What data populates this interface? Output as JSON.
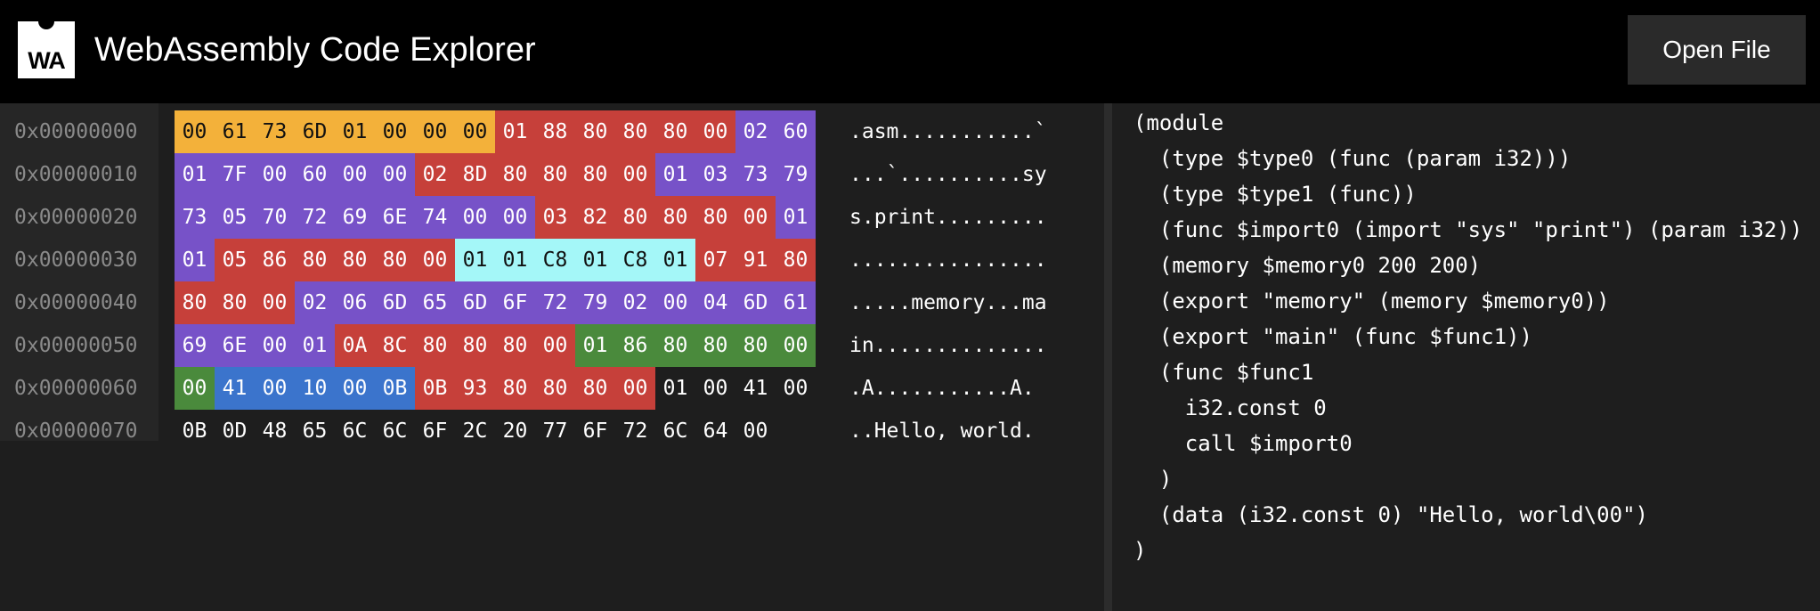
{
  "header": {
    "logo_text": "WA",
    "title": "WebAssembly Code Explorer",
    "open_file_label": "Open File"
  },
  "colors": {
    "header_section": "#f3b13a",
    "section_id_size": "#c6403a",
    "section_payload": "#7752c8",
    "function_body": "#a4f7f8",
    "local_decls": "#4a8a3c",
    "instructions": "#3b74cc"
  },
  "hex": {
    "rows": [
      {
        "addr": "0x00000000",
        "ascii": ".asm...........`",
        "bytes": [
          [
            "00",
            "header"
          ],
          [
            "61",
            "header"
          ],
          [
            "73",
            "header"
          ],
          [
            "6D",
            "header"
          ],
          [
            "01",
            "header"
          ],
          [
            "00",
            "header"
          ],
          [
            "00",
            "header"
          ],
          [
            "00",
            "header"
          ],
          [
            "01",
            "red"
          ],
          [
            "88",
            "red"
          ],
          [
            "80",
            "red"
          ],
          [
            "80",
            "red"
          ],
          [
            "80",
            "red"
          ],
          [
            "00",
            "red"
          ],
          [
            "02",
            "purple"
          ],
          [
            "60",
            "purple"
          ]
        ]
      },
      {
        "addr": "0x00000010",
        "ascii": "...`..........sy",
        "bytes": [
          [
            "01",
            "purple"
          ],
          [
            "7F",
            "purple"
          ],
          [
            "00",
            "purple"
          ],
          [
            "60",
            "purple"
          ],
          [
            "00",
            "purple"
          ],
          [
            "00",
            "purple"
          ],
          [
            "02",
            "red"
          ],
          [
            "8D",
            "red"
          ],
          [
            "80",
            "red"
          ],
          [
            "80",
            "red"
          ],
          [
            "80",
            "red"
          ],
          [
            "00",
            "red"
          ],
          [
            "01",
            "purple"
          ],
          [
            "03",
            "purple"
          ],
          [
            "73",
            "purple"
          ],
          [
            "79",
            "purple"
          ]
        ]
      },
      {
        "addr": "0x00000020",
        "ascii": "s.print.........",
        "bytes": [
          [
            "73",
            "purple"
          ],
          [
            "05",
            "purple"
          ],
          [
            "70",
            "purple"
          ],
          [
            "72",
            "purple"
          ],
          [
            "69",
            "purple"
          ],
          [
            "6E",
            "purple"
          ],
          [
            "74",
            "purple"
          ],
          [
            "00",
            "purple"
          ],
          [
            "00",
            "purple"
          ],
          [
            "03",
            "red"
          ],
          [
            "82",
            "red"
          ],
          [
            "80",
            "red"
          ],
          [
            "80",
            "red"
          ],
          [
            "80",
            "red"
          ],
          [
            "00",
            "red"
          ],
          [
            "01",
            "purple"
          ]
        ]
      },
      {
        "addr": "0x00000030",
        "ascii": "................",
        "bytes": [
          [
            "01",
            "purple"
          ],
          [
            "05",
            "red"
          ],
          [
            "86",
            "red"
          ],
          [
            "80",
            "red"
          ],
          [
            "80",
            "red"
          ],
          [
            "80",
            "red"
          ],
          [
            "00",
            "red"
          ],
          [
            "01",
            "cyan"
          ],
          [
            "01",
            "cyan"
          ],
          [
            "C8",
            "cyan"
          ],
          [
            "01",
            "cyan"
          ],
          [
            "C8",
            "cyan"
          ],
          [
            "01",
            "cyan"
          ],
          [
            "07",
            "red"
          ],
          [
            "91",
            "red"
          ],
          [
            "80",
            "red"
          ]
        ]
      },
      {
        "addr": "0x00000040",
        "ascii": ".....memory...ma",
        "bytes": [
          [
            "80",
            "red"
          ],
          [
            "80",
            "red"
          ],
          [
            "00",
            "red"
          ],
          [
            "02",
            "purple"
          ],
          [
            "06",
            "purple"
          ],
          [
            "6D",
            "purple"
          ],
          [
            "65",
            "purple"
          ],
          [
            "6D",
            "purple"
          ],
          [
            "6F",
            "purple"
          ],
          [
            "72",
            "purple"
          ],
          [
            "79",
            "purple"
          ],
          [
            "02",
            "purple"
          ],
          [
            "00",
            "purple"
          ],
          [
            "04",
            "purple"
          ],
          [
            "6D",
            "purple"
          ],
          [
            "61",
            "purple"
          ]
        ]
      },
      {
        "addr": "0x00000050",
        "ascii": "in..............",
        "bytes": [
          [
            "69",
            "purple"
          ],
          [
            "6E",
            "purple"
          ],
          [
            "00",
            "purple"
          ],
          [
            "01",
            "purple"
          ],
          [
            "0A",
            "red"
          ],
          [
            "8C",
            "red"
          ],
          [
            "80",
            "red"
          ],
          [
            "80",
            "red"
          ],
          [
            "80",
            "red"
          ],
          [
            "00",
            "red"
          ],
          [
            "01",
            "green"
          ],
          [
            "86",
            "green"
          ],
          [
            "80",
            "green"
          ],
          [
            "80",
            "green"
          ],
          [
            "80",
            "green"
          ],
          [
            "00",
            "green"
          ]
        ]
      },
      {
        "addr": "0x00000060",
        "ascii": ".A...........A.",
        "bytes": [
          [
            "00",
            "green"
          ],
          [
            "41",
            "blue"
          ],
          [
            "00",
            "blue"
          ],
          [
            "10",
            "blue"
          ],
          [
            "00",
            "blue"
          ],
          [
            "0B",
            "blue"
          ],
          [
            "0B",
            "red"
          ],
          [
            "93",
            "red"
          ],
          [
            "80",
            "red"
          ],
          [
            "80",
            "red"
          ],
          [
            "80",
            "red"
          ],
          [
            "00",
            "red"
          ],
          [
            "01",
            "none"
          ],
          [
            "00",
            "none"
          ],
          [
            "41",
            "none"
          ],
          [
            "00",
            "none"
          ]
        ]
      },
      {
        "addr": "0x00000070",
        "ascii": "..Hello, world.",
        "bytes": [
          [
            "0B",
            "none"
          ],
          [
            "0D",
            "none"
          ],
          [
            "48",
            "none"
          ],
          [
            "65",
            "none"
          ],
          [
            "6C",
            "none"
          ],
          [
            "6C",
            "none"
          ],
          [
            "6F",
            "none"
          ],
          [
            "2C",
            "none"
          ],
          [
            "20",
            "none"
          ],
          [
            "77",
            "none"
          ],
          [
            "6F",
            "none"
          ],
          [
            "72",
            "none"
          ],
          [
            "6C",
            "none"
          ],
          [
            "64",
            "none"
          ],
          [
            "00",
            "none"
          ]
        ]
      }
    ]
  },
  "code": {
    "lines": [
      "(module",
      "  (type $type0 (func (param i32)))",
      "  (type $type1 (func))",
      "  (func $import0 (import \"sys\" \"print\") (param i32))",
      "  (memory $memory0 200 200)",
      "  (export \"memory\" (memory $memory0))",
      "  (export \"main\" (func $func1))",
      "  (func $func1",
      "    i32.const 0",
      "    call $import0",
      "  )",
      "  (data (i32.const 0) \"Hello, world\\00\")",
      ")"
    ]
  }
}
